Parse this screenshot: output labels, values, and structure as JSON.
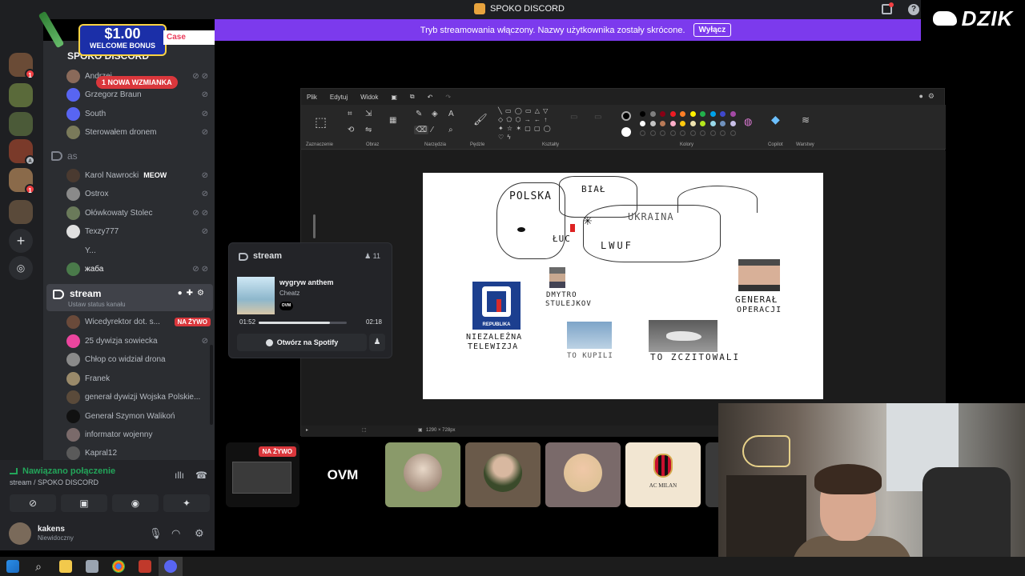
{
  "titlebar": {
    "title": "SPOKO DISCORD"
  },
  "banner": {
    "text": "Tryb streamowania włączony. Nazwy użytkownika zostały skrócone.",
    "button": "Wyłącz"
  },
  "brand_logo": {
    "text": "DZIK"
  },
  "promo": {
    "amount": "$1.00",
    "subtitle": "WELCOME BONUS",
    "brand": "Case"
  },
  "server_rail": {
    "badge_1": "1",
    "badge_2": "1",
    "badge_3": "1",
    "add_label": "+"
  },
  "sidebar": {
    "server_name": "SPOKO DISCORD",
    "mention_pill": "1 NOWA WZMIANKA",
    "group1_users": [
      "Grzegorz Braun",
      "South",
      "Sterowałem dronem"
    ],
    "channel_as": "as",
    "as_users": [
      {
        "name": "Karol Nawrocki",
        "tag": "MEOW"
      },
      {
        "name": "Ostrox"
      },
      {
        "name": "Ołówkowaty Stolec"
      },
      {
        "name": "Texzy777"
      },
      {
        "name": "Y..."
      },
      {
        "name": "жаба"
      }
    ],
    "stream_channel": {
      "name": "stream",
      "status": "Ustaw status kanału"
    },
    "stream_users": [
      {
        "name": "Wicedyrektor dot. s...",
        "tag": "NA ŻYWO"
      },
      {
        "name": "25 dywizja sowiecka"
      },
      {
        "name": "Chłop co widział drona"
      },
      {
        "name": "Franek"
      },
      {
        "name": "generał dywizji Wojska Polskie..."
      },
      {
        "name": "Generał Szymon Walikoń"
      },
      {
        "name": "informator wojenny"
      },
      {
        "name": "Kapral12"
      }
    ]
  },
  "connection": {
    "status": "Nawiązano połączenie",
    "channel": "stream / SPOKO DISCORD"
  },
  "user": {
    "name": "kakens",
    "status": "Niewidoczny"
  },
  "spotify_popup": {
    "channel": "stream",
    "count": "11",
    "track": "wygryw anthem",
    "artist": "Cheatz",
    "artist_badge": "OVM",
    "time_elapsed": "01:52",
    "time_total": "02:18",
    "progress": 0.81,
    "open_button": "Otwórz na Spotify"
  },
  "paint": {
    "menu": [
      "Plik",
      "Edytuj",
      "Widok"
    ],
    "groups": [
      "Zaznaczenie",
      "Obraz",
      "Narzędzia",
      "Pędzle",
      "Kształty",
      "Kolory",
      "Copilot",
      "Warstwy"
    ],
    "status_size": "1290 × 728px",
    "colors": [
      "#000000",
      "#7f7f7f",
      "#880015",
      "#ed1c24",
      "#ff7f27",
      "#fff200",
      "#22b14c",
      "#00a2e8",
      "#3f48cc",
      "#a349a4",
      "#ffffff",
      "#c3c3c3",
      "#b97a57",
      "#ffaec9",
      "#ffc90e",
      "#efe4b0",
      "#b5e61d",
      "#99d9ea",
      "#7092be",
      "#c8bfe7"
    ],
    "drawing_texts": {
      "polska": "POLSKA",
      "bial": "BIAŁ",
      "ukraina": "UKRAINA",
      "luc": "ŁUC",
      "lwuf": "LWUF",
      "dmytro": "DMYTRO",
      "stuledkov": "STULEJKOV",
      "general": "GENERAŁ",
      "operacji": "OPERACJI",
      "niezalezna": "NIEZALEŻNA",
      "telewizja": "TELEWIZJA",
      "republika": "REPUBLIKA",
      "to_kupili": "TO KUPILI",
      "to_zczitowali": "TO ZCZITOWALI"
    }
  },
  "tiles": {
    "live_tag": "NA ŻYWO",
    "ovm": "OVM",
    "milan": "AC MILAN"
  }
}
